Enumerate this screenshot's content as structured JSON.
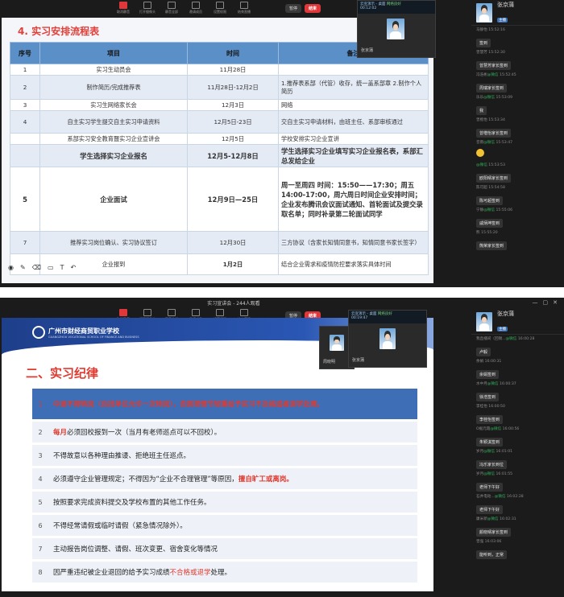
{
  "toolbar": {
    "items": [
      "取消静音",
      "打开摄像头",
      "静音全部",
      "邀请成员",
      "设置权限",
      "结束直播"
    ],
    "pause_label": "暂停",
    "end_label": "结束",
    "window_title": "实习宣讲会 - 244人观看"
  },
  "panel1": {
    "heading": "4. 实习安排流程表",
    "headers": [
      "序号",
      "项目",
      "时间",
      "备注"
    ],
    "rows": [
      [
        "1",
        "实习生动员会",
        "11月28日",
        ""
      ],
      [
        "2",
        "制作简历/完成推荐表",
        "11月28日-12月2日",
        "1.推荐表系部（代管）收存，统一盖系部章 2.制作个人简历"
      ],
      [
        "3",
        "实习生网络家长会",
        "12月3日",
        "网络"
      ],
      [
        "4",
        "自主实习学生提交自主实习申请资料",
        "12月5日-23日",
        "交自主实习申请材料，由班主任、系部审核通过"
      ],
      [
        "",
        "系部实习安全教育暨实习企业宣讲会",
        "12月5日",
        "学校安排实习企业宣讲"
      ],
      [
        "",
        "学生选择实习企业报名",
        "12月5-12月8日",
        "学生选择实习企业填写实习企业报名表，系部汇总发给企业"
      ],
      [
        "5",
        "企业面试",
        "12月9日—25日",
        "周一至周四 时间：15:50——17:30；周五14:00-17:00，周六周日时间企业安排时间；企业发布腾讯会议面试通知、首轮面试及提交录取名单；同时补录第二轮面试同学"
      ],
      [
        "7",
        "推荐实习岗位确认、实习协议签订",
        "12月30日",
        "三方协议（含家长知情同意书，知情同意书家长签字）"
      ],
      [
        "",
        "企业报到",
        "1月2日",
        "结合企业需求和疫情防控要求落实具体时间"
      ]
    ],
    "video_window": {
      "title": "云宣演示 - 桌面",
      "timer": "00:12:02",
      "network": "网络良好",
      "name": "张京蒲"
    }
  },
  "chat1": {
    "host_name": "张京蒲",
    "host_tag": "主播",
    "messages": [
      {
        "user": "马静怡",
        "time": "15:52:16",
        "wechat": "",
        "text": "签到"
      },
      {
        "user": "曾慧芳",
        "time": "15:52:30",
        "wechat": "",
        "text": "曾慧芳家长签到"
      },
      {
        "user": "冯浩彬",
        "time": "15:52:45",
        "wechat": "@微信",
        "text": "周瑞家长签到"
      },
      {
        "user": "乐乐",
        "time": "15:53:09",
        "wechat": "@微信",
        "text": "我"
      },
      {
        "user": "曾楷怡",
        "time": "15:53:34",
        "wechat": "",
        "text": "曾楷怡家长签到"
      },
      {
        "user": "音雨",
        "time": "15:53:47",
        "wechat": "@微信",
        "text": ""
      },
      {
        "user": "",
        "time": "15:53:53",
        "wechat": "@微信",
        "text": "欧阳晴家长签到"
      },
      {
        "user": "陈可超",
        "time": "15:54:58",
        "wechat": "",
        "text": "陈可超签到"
      },
      {
        "user": "宁静",
        "time": "15:55:06",
        "wechat": "@微信",
        "text": "戚炳坤签到"
      },
      {
        "user": "熊",
        "time": "15:55:20",
        "wechat": "",
        "text": "熊荣家长签到"
      }
    ]
  },
  "panel2": {
    "school_cn": "广州市财经商贸职业学校",
    "school_en": "GUANGZHOU VOCATIONAL SCHOOL OF FINANCE AND BUSINESS",
    "title": "二、实习纪律",
    "rules": [
      {
        "n": "1",
        "a": "中途不得转岗（自找单位允许一次转岗），否则视情节轻重给予实习不及格或者退学处理。",
        "b": "",
        "c": ""
      },
      {
        "n": "2",
        "a": "",
        "b": "每月",
        "c": "必须回校报到一次（当月有老师巡点可以不回校）。"
      },
      {
        "n": "3",
        "a": "不得故意以各种理由推诿、拒绝班主任巡点。",
        "b": "",
        "c": ""
      },
      {
        "n": "4",
        "a": "必须遵守企业管理规定；不得因为“企业不合理管理”等原因，",
        "b": "擅自旷工或离岗。",
        "c": ""
      },
      {
        "n": "5",
        "a": "按照要求完成资料提交及学校布置的其他工作任务。",
        "b": "",
        "c": ""
      },
      {
        "n": "6",
        "a": "不得经常请假或临时请假（紧急情况除外）。",
        "b": "",
        "c": ""
      },
      {
        "n": "7",
        "a": "主动报告岗位调整、请假、班次变更、宿舍变化等情况",
        "b": "",
        "c": ""
      },
      {
        "n": "8",
        "a": "因严重违纪被企业退回的给予实习成绩",
        "b": "不合格或退学",
        "c": "处理。"
      }
    ],
    "video_small": {
      "name": "周晓明"
    },
    "video_window": {
      "title": "云宣演示 - 桌面",
      "timer": "00:19:47",
      "network": "网络良好",
      "name": "张京蒲"
    }
  },
  "chat2": {
    "host_name": "张京蒲",
    "host_tag": "主播",
    "messages": [
      {
        "user": "我直播间（回锡...",
        "time": "16:00:28",
        "wechat": "@微信",
        "text": "卢毅"
      },
      {
        "user": "余娟",
        "time": "16:00:31",
        "wechat": "",
        "text": "余娟签到"
      },
      {
        "user": "水中月",
        "time": "16:00:37",
        "wechat": "@微信",
        "text": "徐浩签到"
      },
      {
        "user": "李桂怡",
        "time": "16:00:50",
        "wechat": "",
        "text": "李桂怡签到"
      },
      {
        "user": "O据元霞",
        "time": "16:00:56",
        "wechat": "@微信",
        "text": "朱颖淇签到"
      },
      {
        "user": "岁月",
        "time": "16:01:01",
        "wechat": "@微信",
        "text": "冯乐家长到位"
      },
      {
        "user": "岁月",
        "time": "16:01:55",
        "wechat": "@微信",
        "text": "老师下午好"
      },
      {
        "user": "石井电动...",
        "time": "16:02:28",
        "wechat": "@微信",
        "text": "老师下午好"
      },
      {
        "user": "康米新",
        "time": "16:02:31",
        "wechat": "@微信",
        "text": "颜晓晴家长签到"
      },
      {
        "user": "曾强",
        "time": "16:03:06",
        "wechat": "",
        "text": "能听到，正常"
      }
    ]
  }
}
